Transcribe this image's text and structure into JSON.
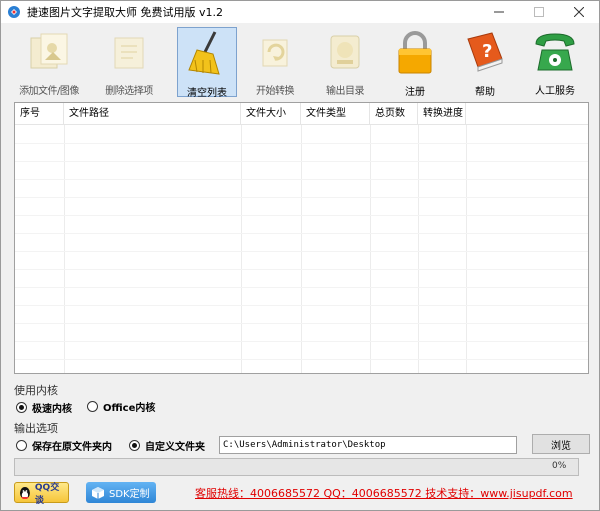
{
  "window": {
    "title": "捷速图片文字提取大师 免费试用版 v1.2"
  },
  "toolbar": {
    "items": [
      {
        "label": "添加文件/图像",
        "icon": "add-file-icon"
      },
      {
        "label": "删除选择项",
        "icon": "delete-icon"
      },
      {
        "label": "清空列表",
        "icon": "broom-icon"
      },
      {
        "label": "开始转换",
        "icon": "convert-icon"
      },
      {
        "label": "输出目录",
        "icon": "folder-icon"
      },
      {
        "label": "注册",
        "icon": "lock-icon"
      },
      {
        "label": "帮助",
        "icon": "help-book-icon"
      },
      {
        "label": "人工服务",
        "icon": "phone-icon"
      }
    ]
  },
  "table": {
    "columns": [
      "序号",
      "文件路径",
      "文件大小",
      "文件类型",
      "总页数",
      "转换进度"
    ]
  },
  "engine": {
    "label": "使用内核",
    "options": [
      "极速内核",
      "Office内核"
    ],
    "selected": "极速内核"
  },
  "output": {
    "label": "输出选项",
    "options": [
      "保存在原文件夹内",
      "自定义文件夹"
    ],
    "selected": "自定义文件夹",
    "path": "C:\\Users\\Administrator\\Desktop",
    "browse_label": "浏览"
  },
  "progress": {
    "value": 0,
    "text": "0%"
  },
  "footer": {
    "qq_label": "QQ交谈",
    "sdk_label": "SDK定制",
    "hotline": "客服热线：4006685572 QQ：4006685572 技术支持：www.jisupdf.com"
  },
  "colors": {
    "accent": "#cde2f7",
    "hotline": "#e00000",
    "progress": "#06b025"
  }
}
